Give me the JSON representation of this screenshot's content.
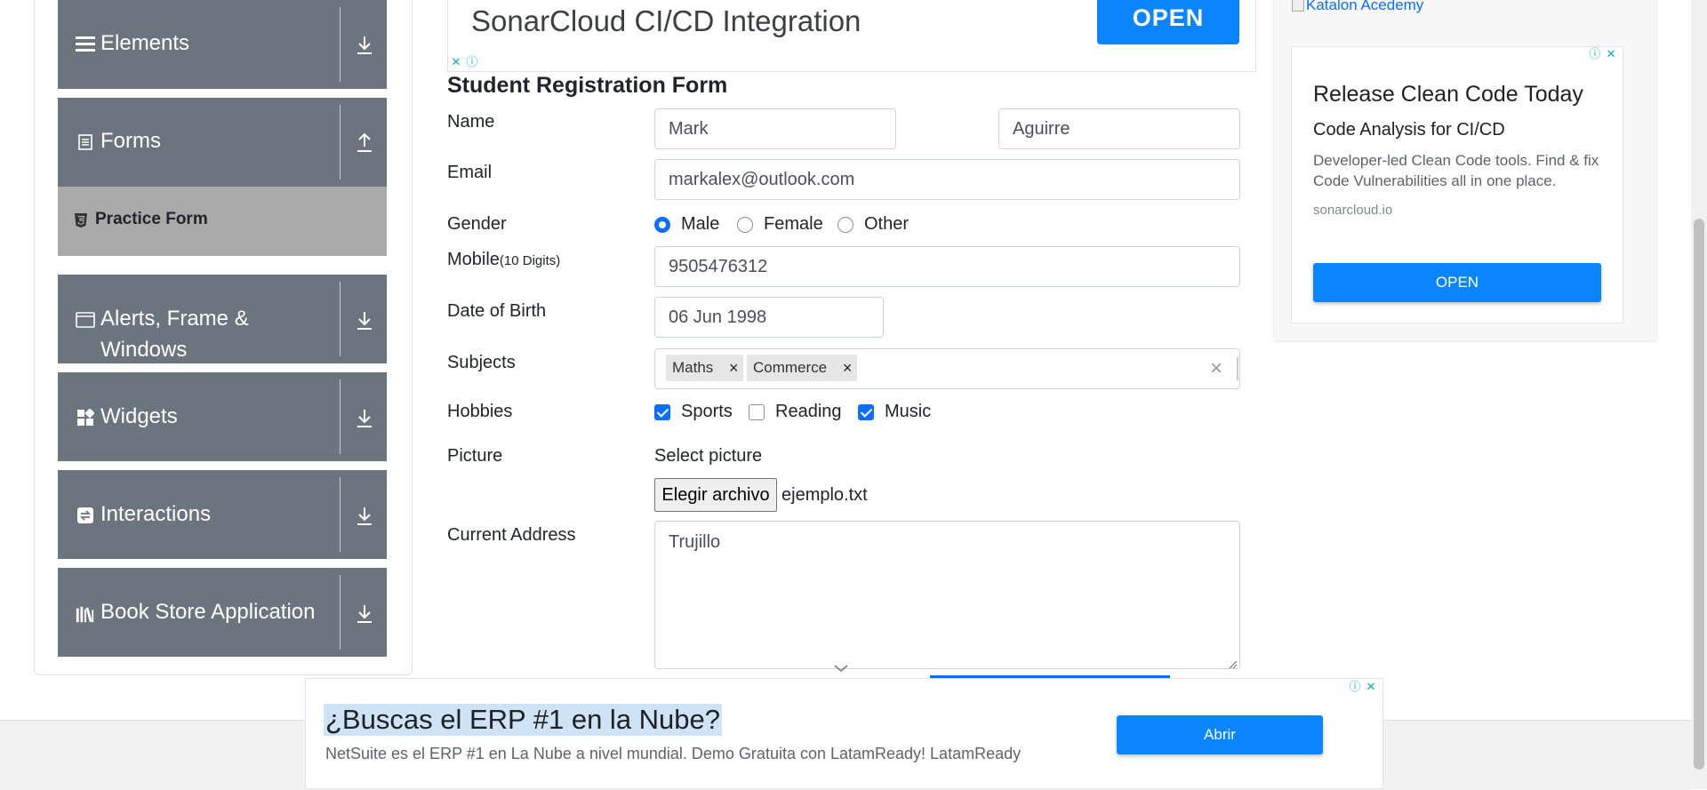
{
  "sidebar": {
    "groups": [
      {
        "label": "Elements",
        "icon": "list-icon",
        "arrow": "download-arrow-icon"
      },
      {
        "label": "Forms",
        "icon": "document-icon",
        "arrow": "upload-arrow-icon"
      },
      {
        "label": "Alerts, Frame &",
        "label2": "Windows",
        "icon": "window-icon",
        "arrow": "download-arrow-icon"
      },
      {
        "label": "Widgets",
        "icon": "widgets-icon",
        "arrow": "download-arrow-icon"
      },
      {
        "label": "Interactions",
        "icon": "interactions-icon",
        "arrow": "download-arrow-icon"
      },
      {
        "label": "Book Store Application",
        "icon": "books-icon",
        "arrow": "download-arrow-icon"
      }
    ],
    "active_item": {
      "label": "Practice Form",
      "icon": "html5-icon"
    }
  },
  "top_ad": {
    "title": "SonarCloud CI/CD Integration",
    "button": "OPEN"
  },
  "form": {
    "title": "Student Registration Form",
    "name": {
      "label": "Name",
      "first": "Mark",
      "last": "Aguirre"
    },
    "email": {
      "label": "Email",
      "value": "markalex@outlook.com"
    },
    "gender": {
      "label": "Gender",
      "options": [
        "Male",
        "Female",
        "Other"
      ],
      "selected": "Male"
    },
    "mobile": {
      "label": "Mobile",
      "hint": "(10 Digits)",
      "value": "9505476312"
    },
    "dob": {
      "label": "Date of Birth",
      "value": "06 Jun 1998"
    },
    "subjects": {
      "label": "Subjects",
      "chips": [
        "Maths",
        "Commerce"
      ],
      "clear": "×",
      "chip_remove": "×"
    },
    "hobbies": {
      "label": "Hobbies",
      "options": [
        {
          "label": "Sports",
          "checked": true
        },
        {
          "label": "Reading",
          "checked": false
        },
        {
          "label": "Music",
          "checked": true
        }
      ]
    },
    "picture": {
      "label": "Picture",
      "select_text": "Select picture",
      "button": "Elegir archivo",
      "file": "ejemplo.txt"
    },
    "address": {
      "label": "Current Address",
      "value": "Trujillo"
    }
  },
  "right_ad": {
    "image_alt": "Katalon Acedemy",
    "headline": "Release Clean Code Today",
    "subheadline": "Code Analysis for CI/CD",
    "body": "Developer-led Clean Code tools. Find & fix Code Vulnerabilities all in one place.",
    "domain": "sonarcloud.io",
    "button": "OPEN"
  },
  "bottom_ad": {
    "headline": "¿Buscas el ERP #1 en la Nube?",
    "body": "NetSuite es el ERP #1 en La Nube a nivel mundial. Demo Gratuita con LatamReady! LatamReady",
    "button": "Abrir"
  },
  "colors": {
    "sidebar": "#6c757d",
    "active": "#aaaaaa",
    "primary": "#0d6efd",
    "ad_button": "#0a84ff"
  }
}
